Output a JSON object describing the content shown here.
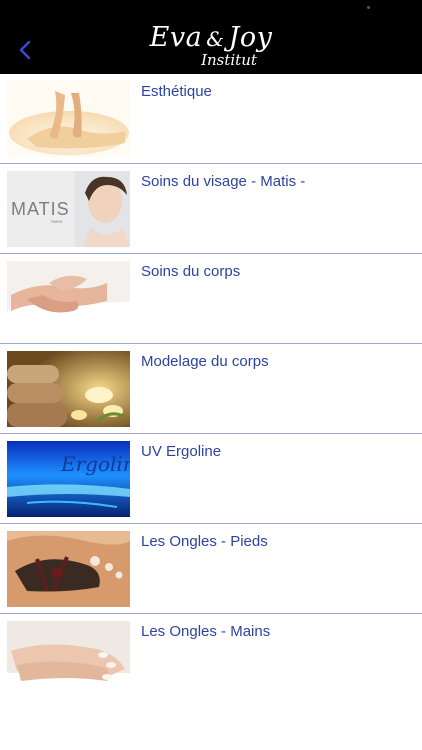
{
  "header": {
    "logo_line1a": "Eva",
    "logo_amp": "&",
    "logo_line1b": "Joy",
    "logo_line2": "Institut",
    "back_icon": "chevron-left-icon",
    "back_color": "#3a4bd8"
  },
  "items": [
    {
      "label": "Esthétique",
      "thumb": "feet-on-towel"
    },
    {
      "label": "Soins du visage - Matis -",
      "thumb": "matis-woman-face",
      "thumb_text": "MATIS",
      "thumb_subtext": "PARIS"
    },
    {
      "label": "Soins du corps",
      "thumb": "massage-hands"
    },
    {
      "label": "Modelage du corps",
      "thumb": "towels-candles"
    },
    {
      "label": "UV Ergoline",
      "thumb": "ergoline-tanning-bed",
      "thumb_text": "Ergolin"
    },
    {
      "label": "Les Ongles - Pieds",
      "thumb": "pedicure-feet"
    },
    {
      "label": "Les Ongles - Mains",
      "thumb": "manicure-hands"
    }
  ],
  "colors": {
    "header_bg": "#000000",
    "label": "#2c44a0",
    "divider": "#9fa6c9"
  }
}
